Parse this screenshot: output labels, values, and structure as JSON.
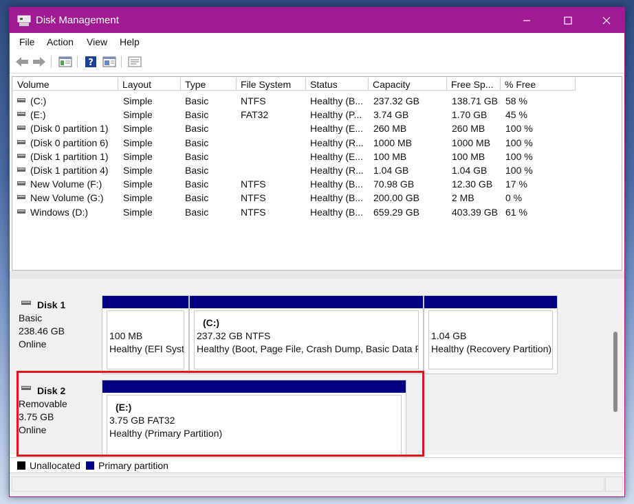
{
  "window": {
    "title": "Disk Management"
  },
  "menu": [
    "File",
    "Action",
    "View",
    "Help"
  ],
  "toolbar": {
    "icons": [
      "back-arrow-icon",
      "forward-arrow-icon",
      "console-tree-icon",
      "help-icon",
      "properties-icon",
      "list-view-icon"
    ]
  },
  "volumes": {
    "columns": [
      "Volume",
      "Layout",
      "Type",
      "File System",
      "Status",
      "Capacity",
      "Free Sp...",
      "% Free"
    ],
    "rows": [
      {
        "volume": "(C:)",
        "layout": "Simple",
        "type": "Basic",
        "fs": "NTFS",
        "status": "Healthy (B...",
        "capacity": "237.32 GB",
        "free": "138.71 GB",
        "pct": "58 %"
      },
      {
        "volume": "(E:)",
        "layout": "Simple",
        "type": "Basic",
        "fs": "FAT32",
        "status": "Healthy (P...",
        "capacity": "3.74 GB",
        "free": "1.70 GB",
        "pct": "45 %"
      },
      {
        "volume": "(Disk 0 partition 1)",
        "layout": "Simple",
        "type": "Basic",
        "fs": "",
        "status": "Healthy (E...",
        "capacity": "260 MB",
        "free": "260 MB",
        "pct": "100 %"
      },
      {
        "volume": "(Disk 0 partition 6)",
        "layout": "Simple",
        "type": "Basic",
        "fs": "",
        "status": "Healthy (R...",
        "capacity": "1000 MB",
        "free": "1000 MB",
        "pct": "100 %"
      },
      {
        "volume": "(Disk 1 partition 1)",
        "layout": "Simple",
        "type": "Basic",
        "fs": "",
        "status": "Healthy (E...",
        "capacity": "100 MB",
        "free": "100 MB",
        "pct": "100 %"
      },
      {
        "volume": "(Disk 1 partition 4)",
        "layout": "Simple",
        "type": "Basic",
        "fs": "",
        "status": "Healthy (R...",
        "capacity": "1.04 GB",
        "free": "1.04 GB",
        "pct": "100 %"
      },
      {
        "volume": "New Volume (F:)",
        "layout": "Simple",
        "type": "Basic",
        "fs": "NTFS",
        "status": "Healthy (B...",
        "capacity": "70.98 GB",
        "free": "12.30 GB",
        "pct": "17 %"
      },
      {
        "volume": "New Volume (G:)",
        "layout": "Simple",
        "type": "Basic",
        "fs": "NTFS",
        "status": "Healthy (B...",
        "capacity": "200.00 GB",
        "free": "2 MB",
        "pct": "0 %"
      },
      {
        "volume": "Windows (D:)",
        "layout": "Simple",
        "type": "Basic",
        "fs": "NTFS",
        "status": "Healthy (B...",
        "capacity": "659.29 GB",
        "free": "403.39 GB",
        "pct": "61 %"
      }
    ]
  },
  "disks": [
    {
      "name": "Disk 1",
      "kind": "Basic",
      "size": "238.46 GB",
      "state": "Online",
      "partitions": [
        {
          "label": "",
          "line1": "100 MB",
          "line2": "Healthy (EFI System Partition)"
        },
        {
          "label": "(C:)",
          "line1": "237.32 GB NTFS",
          "line2": "Healthy (Boot, Page File, Crash Dump, Basic Data Partition)"
        },
        {
          "label": "",
          "line1": "1.04 GB",
          "line2": "Healthy (Recovery Partition)"
        }
      ]
    },
    {
      "name": "Disk 2",
      "kind": "Removable",
      "size": "3.75 GB",
      "state": "Online",
      "partitions": [
        {
          "label": "(E:)",
          "line1": "3.75 GB FAT32",
          "line2": "Healthy (Primary Partition)"
        }
      ]
    }
  ],
  "legend": [
    {
      "label": "Unallocated",
      "color": "#000000"
    },
    {
      "label": "Primary partition",
      "color": "#000080"
    }
  ],
  "colors": {
    "titlebar": "#9f1a93",
    "partition_bar": "#000080",
    "highlight": "#e3141c"
  }
}
